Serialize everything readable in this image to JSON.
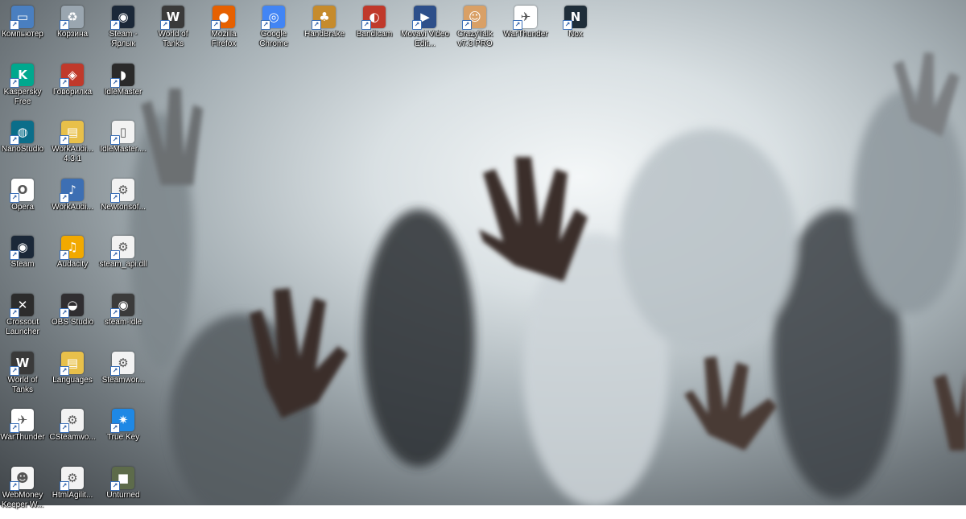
{
  "desktop": {
    "icons": [
      {
        "label": "Компьютер",
        "icon": "computer-icon",
        "bg": "#4a7fc0",
        "glyph": "▭",
        "col": 0,
        "row": 0
      },
      {
        "label": "Корзина",
        "icon": "recycle-bin-icon",
        "bg": "#9aa6b0",
        "glyph": "♻",
        "col": 1,
        "row": 0
      },
      {
        "label": "Steam - Ярлык",
        "icon": "steam-icon",
        "bg": "#1b2838",
        "glyph": "◉",
        "col": 2,
        "row": 0
      },
      {
        "label": "World of Tanks",
        "icon": "world-of-tanks-icon",
        "bg": "#3a3a3a",
        "glyph": "W",
        "col": 3,
        "row": 0
      },
      {
        "label": "Mozilla Firefox",
        "icon": "firefox-icon",
        "bg": "#e66000",
        "glyph": "●",
        "col": 4,
        "row": 0
      },
      {
        "label": "Google Chrome",
        "icon": "chrome-icon",
        "bg": "#4285f4",
        "glyph": "◎",
        "col": 5,
        "row": 0
      },
      {
        "label": "HandBrake",
        "icon": "handbrake-icon",
        "bg": "#c68b2c",
        "glyph": "♣",
        "col": 6,
        "row": 0
      },
      {
        "label": "Bandicam",
        "icon": "bandicam-icon",
        "bg": "#c0392b",
        "glyph": "◐",
        "col": 7,
        "row": 0
      },
      {
        "label": "Movavi Video Edit...",
        "icon": "movavi-icon",
        "bg": "#2d4f8a",
        "glyph": "▶",
        "col": 8,
        "row": 0
      },
      {
        "label": "CrazyTalk v7.3 PRO",
        "icon": "crazytalk-icon",
        "bg": "#d9a066",
        "glyph": "☺",
        "col": 9,
        "row": 0
      },
      {
        "label": "WarThunder",
        "icon": "warthunder-icon",
        "bg": "#ffffff",
        "glyph": "✈",
        "col": 10,
        "row": 0
      },
      {
        "label": "Nox",
        "icon": "nox-icon",
        "bg": "#1f2e3a",
        "glyph": "N",
        "col": 11,
        "row": 0
      },
      {
        "label": "Kaspersky Free",
        "icon": "kaspersky-icon",
        "bg": "#00a88e",
        "glyph": "K",
        "col": 0,
        "row": 1
      },
      {
        "label": "Говорилка",
        "icon": "govorilka-icon",
        "bg": "#c0392b",
        "glyph": "◈",
        "col": 1,
        "row": 1
      },
      {
        "label": "IdleMaster",
        "icon": "idlemaster-icon",
        "bg": "#2a2a2a",
        "glyph": "◗",
        "col": 2,
        "row": 1
      },
      {
        "label": "NanoStudio",
        "icon": "nanostudio-icon",
        "bg": "#0b6e8a",
        "glyph": "◍",
        "col": 0,
        "row": 2
      },
      {
        "label": "WorkAudi... 4.3.1",
        "icon": "folder-icon",
        "bg": "#e8c04a",
        "glyph": "▤",
        "col": 1,
        "row": 2
      },
      {
        "label": "IdleMaster....",
        "icon": "file-icon",
        "bg": "#f2f2f2",
        "glyph": "▯",
        "col": 2,
        "row": 2
      },
      {
        "label": "Opera",
        "icon": "opera-icon",
        "bg": "#ffffff",
        "glyph": "O",
        "col": 0,
        "row": 3
      },
      {
        "label": "WorkAudi...",
        "icon": "workaudio-icon",
        "bg": "#3d6fb3",
        "glyph": "♪",
        "col": 1,
        "row": 3
      },
      {
        "label": "Newtonsof...",
        "icon": "dll-file-icon",
        "bg": "#f2f2f2",
        "glyph": "⚙",
        "col": 2,
        "row": 3
      },
      {
        "label": "Steam",
        "icon": "steam-icon",
        "bg": "#1b2838",
        "glyph": "◉",
        "col": 0,
        "row": 4
      },
      {
        "label": "Audacity",
        "icon": "audacity-icon",
        "bg": "#f2a900",
        "glyph": "♫",
        "col": 1,
        "row": 4
      },
      {
        "label": "steam_api.dll",
        "icon": "dll-file-icon",
        "bg": "#f2f2f2",
        "glyph": "⚙",
        "col": 2,
        "row": 4
      },
      {
        "label": "Crossout Launcher",
        "icon": "crossout-icon",
        "bg": "#2c2c2c",
        "glyph": "✕",
        "col": 0,
        "row": 5
      },
      {
        "label": "OBS Studio",
        "icon": "obs-icon",
        "bg": "#302e31",
        "glyph": "◒",
        "col": 1,
        "row": 5
      },
      {
        "label": "steam-idle",
        "icon": "steam-idle-icon",
        "bg": "#3b3b3b",
        "glyph": "◉",
        "col": 2,
        "row": 5
      },
      {
        "label": "World of Tanks",
        "icon": "world-of-tanks-icon",
        "bg": "#3a3a3a",
        "glyph": "W",
        "col": 0,
        "row": 6
      },
      {
        "label": "Languages",
        "icon": "folder-icon",
        "bg": "#e8c04a",
        "glyph": "▤",
        "col": 1,
        "row": 6
      },
      {
        "label": "Steamwor...",
        "icon": "dll-file-icon",
        "bg": "#f2f2f2",
        "glyph": "⚙",
        "col": 2,
        "row": 6
      },
      {
        "label": "WarThunder",
        "icon": "warthunder-icon",
        "bg": "#ffffff",
        "glyph": "✈",
        "col": 0,
        "row": 7
      },
      {
        "label": "CSteamwo...",
        "icon": "dll-file-icon",
        "bg": "#f2f2f2",
        "glyph": "⚙",
        "col": 1,
        "row": 7
      },
      {
        "label": "True Key",
        "icon": "true-key-icon",
        "bg": "#1e88e5",
        "glyph": "✷",
        "col": 2,
        "row": 7
      },
      {
        "label": "WebMoney Keeper W...",
        "icon": "webmoney-icon",
        "bg": "#f5f5f5",
        "glyph": "☻",
        "col": 0,
        "row": 8
      },
      {
        "label": "HtmlAgilit...",
        "icon": "dll-file-icon",
        "bg": "#f2f2f2",
        "glyph": "⚙",
        "col": 1,
        "row": 8
      },
      {
        "label": "Unturned",
        "icon": "unturned-icon",
        "bg": "#5d6b4a",
        "glyph": "■",
        "col": 2,
        "row": 8
      }
    ]
  }
}
